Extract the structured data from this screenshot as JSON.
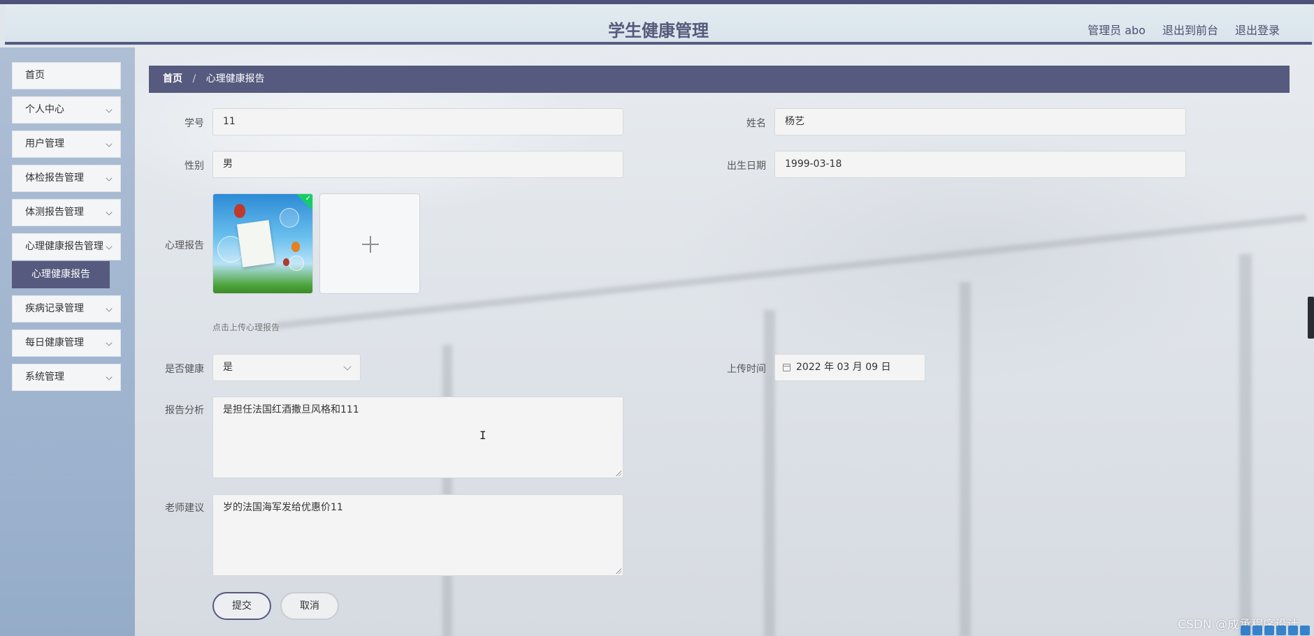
{
  "header": {
    "title": "学生健康管理",
    "admin_label": "管理员 abo",
    "exit_to_front": "退出到前台",
    "logout": "退出登录"
  },
  "sidebar": {
    "items": [
      {
        "label": "首页"
      },
      {
        "label": "个人中心"
      },
      {
        "label": "用户管理"
      },
      {
        "label": "体检报告管理"
      },
      {
        "label": "体测报告管理"
      },
      {
        "label": "心理健康报告管理"
      },
      {
        "label": "疾病记录管理"
      },
      {
        "label": "每日健康管理"
      },
      {
        "label": "系统管理"
      }
    ],
    "active_sub": "心理健康报告"
  },
  "breadcrumb": {
    "home": "首页",
    "separator": "/",
    "current": "心理健康报告"
  },
  "form": {
    "student_id": {
      "label": "学号",
      "value": "11"
    },
    "name": {
      "label": "姓名",
      "value": "杨艺"
    },
    "gender": {
      "label": "性别",
      "value": "男"
    },
    "birth_date": {
      "label": "出生日期",
      "value": "1999-03-18"
    },
    "report": {
      "label": "心理报告",
      "hint": "点击上传心理报告"
    },
    "is_healthy": {
      "label": "是否健康",
      "value": "是"
    },
    "upload_time": {
      "label": "上传时间",
      "value": "2022 年 03 月 09 日"
    },
    "analysis": {
      "label": "报告分析",
      "value": "是担任法国红酒撒旦风格和111"
    },
    "advice": {
      "label": "老师建议",
      "value": "岁的法国海军发给优惠价11"
    },
    "submit": "提交",
    "cancel": "取消"
  },
  "watermark": "CSDN @成承程序设计",
  "colors": {
    "accent": "#555a7e",
    "sidebar_bg": "#9fb4cf",
    "success": "#13ce66"
  }
}
